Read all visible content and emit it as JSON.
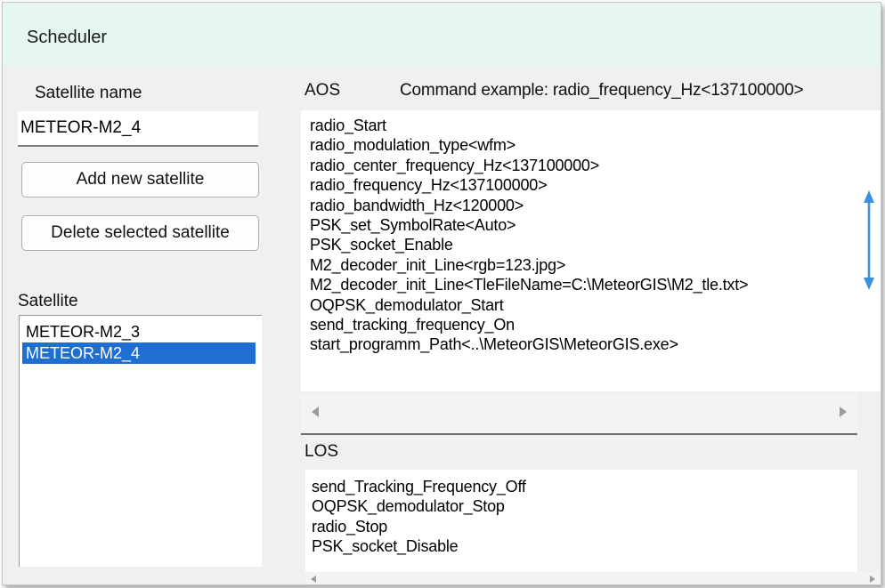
{
  "window": {
    "title": "Scheduler"
  },
  "left_panel": {
    "satellite_name_label": "Satellite name",
    "satellite_name_value": "METEOR-M2_4",
    "add_button": "Add new satellite",
    "delete_button": "Delete selected satellite",
    "satellite_list_label": "Satellite",
    "satellites": [
      {
        "name": "METEOR-M2_3",
        "selected": false
      },
      {
        "name": "METEOR-M2_4",
        "selected": true
      }
    ]
  },
  "aos": {
    "label": "AOS",
    "command_example": "Command example: radio_frequency_Hz<137100000>",
    "commands": [
      "radio_Start",
      "radio_modulation_type<wfm>",
      "radio_center_frequency_Hz<137100000>",
      "radio_frequency_Hz<137100000>",
      "radio_bandwidth_Hz<120000>",
      "PSK_set_SymbolRate<Auto>",
      "PSK_socket_Enable",
      "M2_decoder_init_Line<rgb=123.jpg>",
      "M2_decoder_init_Line<TleFileName=C:\\MeteorGIS\\M2_tle.txt>",
      "OQPSK_demodulator_Start",
      "send_tracking_frequency_On",
      "start_programm_Path<..\\MeteorGIS\\MeteorGIS.exe>"
    ]
  },
  "los": {
    "label": "LOS",
    "commands": [
      "send_Tracking_Frequency_Off",
      "OQPSK_demodulator_Stop",
      "radio_Stop",
      "PSK_socket_Disable"
    ]
  },
  "colors": {
    "title_bar": "#e6f6f1",
    "selection": "#1f6fd1",
    "resize_arrow": "#3a8ee0"
  },
  "icons": {
    "scroll_left": "scroll-left-arrow-icon",
    "scroll_right": "scroll-right-arrow-icon",
    "resize_vertical": "vertical-resize-arrow-icon"
  }
}
